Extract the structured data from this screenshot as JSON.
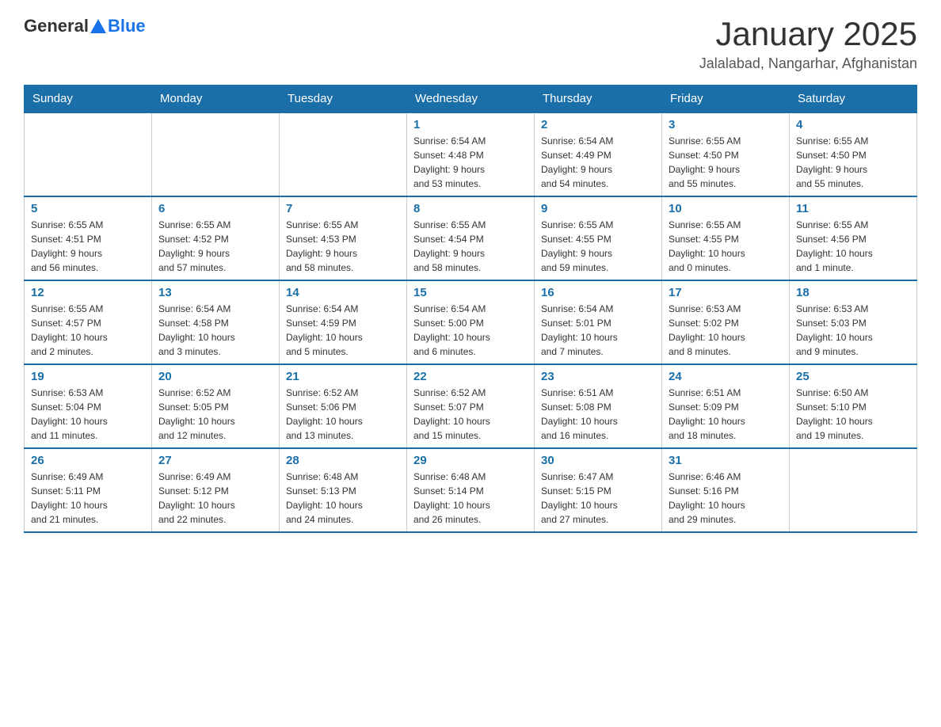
{
  "header": {
    "logo_general": "General",
    "logo_blue": "Blue",
    "month_title": "January 2025",
    "location": "Jalalabad, Nangarhar, Afghanistan"
  },
  "days_of_week": [
    "Sunday",
    "Monday",
    "Tuesday",
    "Wednesday",
    "Thursday",
    "Friday",
    "Saturday"
  ],
  "weeks": [
    [
      {
        "day": "",
        "info": ""
      },
      {
        "day": "",
        "info": ""
      },
      {
        "day": "",
        "info": ""
      },
      {
        "day": "1",
        "info": "Sunrise: 6:54 AM\nSunset: 4:48 PM\nDaylight: 9 hours\nand 53 minutes."
      },
      {
        "day": "2",
        "info": "Sunrise: 6:54 AM\nSunset: 4:49 PM\nDaylight: 9 hours\nand 54 minutes."
      },
      {
        "day": "3",
        "info": "Sunrise: 6:55 AM\nSunset: 4:50 PM\nDaylight: 9 hours\nand 55 minutes."
      },
      {
        "day": "4",
        "info": "Sunrise: 6:55 AM\nSunset: 4:50 PM\nDaylight: 9 hours\nand 55 minutes."
      }
    ],
    [
      {
        "day": "5",
        "info": "Sunrise: 6:55 AM\nSunset: 4:51 PM\nDaylight: 9 hours\nand 56 minutes."
      },
      {
        "day": "6",
        "info": "Sunrise: 6:55 AM\nSunset: 4:52 PM\nDaylight: 9 hours\nand 57 minutes."
      },
      {
        "day": "7",
        "info": "Sunrise: 6:55 AM\nSunset: 4:53 PM\nDaylight: 9 hours\nand 58 minutes."
      },
      {
        "day": "8",
        "info": "Sunrise: 6:55 AM\nSunset: 4:54 PM\nDaylight: 9 hours\nand 58 minutes."
      },
      {
        "day": "9",
        "info": "Sunrise: 6:55 AM\nSunset: 4:55 PM\nDaylight: 9 hours\nand 59 minutes."
      },
      {
        "day": "10",
        "info": "Sunrise: 6:55 AM\nSunset: 4:55 PM\nDaylight: 10 hours\nand 0 minutes."
      },
      {
        "day": "11",
        "info": "Sunrise: 6:55 AM\nSunset: 4:56 PM\nDaylight: 10 hours\nand 1 minute."
      }
    ],
    [
      {
        "day": "12",
        "info": "Sunrise: 6:55 AM\nSunset: 4:57 PM\nDaylight: 10 hours\nand 2 minutes."
      },
      {
        "day": "13",
        "info": "Sunrise: 6:54 AM\nSunset: 4:58 PM\nDaylight: 10 hours\nand 3 minutes."
      },
      {
        "day": "14",
        "info": "Sunrise: 6:54 AM\nSunset: 4:59 PM\nDaylight: 10 hours\nand 5 minutes."
      },
      {
        "day": "15",
        "info": "Sunrise: 6:54 AM\nSunset: 5:00 PM\nDaylight: 10 hours\nand 6 minutes."
      },
      {
        "day": "16",
        "info": "Sunrise: 6:54 AM\nSunset: 5:01 PM\nDaylight: 10 hours\nand 7 minutes."
      },
      {
        "day": "17",
        "info": "Sunrise: 6:53 AM\nSunset: 5:02 PM\nDaylight: 10 hours\nand 8 minutes."
      },
      {
        "day": "18",
        "info": "Sunrise: 6:53 AM\nSunset: 5:03 PM\nDaylight: 10 hours\nand 9 minutes."
      }
    ],
    [
      {
        "day": "19",
        "info": "Sunrise: 6:53 AM\nSunset: 5:04 PM\nDaylight: 10 hours\nand 11 minutes."
      },
      {
        "day": "20",
        "info": "Sunrise: 6:52 AM\nSunset: 5:05 PM\nDaylight: 10 hours\nand 12 minutes."
      },
      {
        "day": "21",
        "info": "Sunrise: 6:52 AM\nSunset: 5:06 PM\nDaylight: 10 hours\nand 13 minutes."
      },
      {
        "day": "22",
        "info": "Sunrise: 6:52 AM\nSunset: 5:07 PM\nDaylight: 10 hours\nand 15 minutes."
      },
      {
        "day": "23",
        "info": "Sunrise: 6:51 AM\nSunset: 5:08 PM\nDaylight: 10 hours\nand 16 minutes."
      },
      {
        "day": "24",
        "info": "Sunrise: 6:51 AM\nSunset: 5:09 PM\nDaylight: 10 hours\nand 18 minutes."
      },
      {
        "day": "25",
        "info": "Sunrise: 6:50 AM\nSunset: 5:10 PM\nDaylight: 10 hours\nand 19 minutes."
      }
    ],
    [
      {
        "day": "26",
        "info": "Sunrise: 6:49 AM\nSunset: 5:11 PM\nDaylight: 10 hours\nand 21 minutes."
      },
      {
        "day": "27",
        "info": "Sunrise: 6:49 AM\nSunset: 5:12 PM\nDaylight: 10 hours\nand 22 minutes."
      },
      {
        "day": "28",
        "info": "Sunrise: 6:48 AM\nSunset: 5:13 PM\nDaylight: 10 hours\nand 24 minutes."
      },
      {
        "day": "29",
        "info": "Sunrise: 6:48 AM\nSunset: 5:14 PM\nDaylight: 10 hours\nand 26 minutes."
      },
      {
        "day": "30",
        "info": "Sunrise: 6:47 AM\nSunset: 5:15 PM\nDaylight: 10 hours\nand 27 minutes."
      },
      {
        "day": "31",
        "info": "Sunrise: 6:46 AM\nSunset: 5:16 PM\nDaylight: 10 hours\nand 29 minutes."
      },
      {
        "day": "",
        "info": ""
      }
    ]
  ]
}
